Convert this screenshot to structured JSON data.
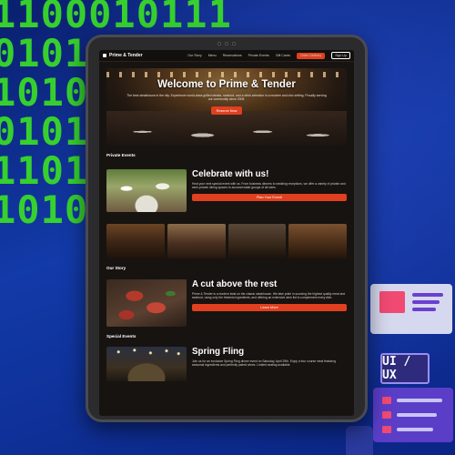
{
  "background_text": {
    "binary_lines": [
      "1100010111",
      "01010",
      "101010",
      "01010",
      "11010",
      "101010"
    ]
  },
  "site": {
    "brand": "Prime & Tender",
    "nav_links": [
      "Our Story",
      "Menu",
      "Reservations",
      "Private Events",
      "Gift Cards"
    ],
    "order_button": "Order Delivery",
    "signup_button": "Sign Up"
  },
  "hero": {
    "title": "Welcome to Prime & Tender",
    "subtitle": "The best steakhouse in the city. Experience world-class grilled steaks, seafood, and a drink selection in a modern and chic setting. Proudly serving our community since 2005.",
    "button": "Reserve Now"
  },
  "private_events": {
    "section_label": "Private Events",
    "title": "Celebrate with us!",
    "text": "Host your next special event with us. From business dinners to wedding receptions, we offer a variety of private and semi-private dining spaces to accommodate groups of all sizes.",
    "button": "Plan Your Event!"
  },
  "our_story": {
    "section_label": "Our Story",
    "title": "A cut above the rest",
    "text": "Prime & Tender is a modern twist on the classic steakhouse. We take pride in sourcing the highest quality meat and seafood, using only the freshest ingredients, and offering an extensive wine list to complement every dish.",
    "button": "Learn More"
  },
  "special_events": {
    "section_label": "Special Events",
    "title": "Spring Fling",
    "text": "Join us for an exclusive Spring Fling dinner event on Saturday, April 29th. Enjoy a four course meal featuring seasonal ingredients and perfectly paired wines. Limited seating available."
  },
  "decor": {
    "badge": "UI / UX"
  },
  "colors": {
    "accent": "#e0401f",
    "page_bg": "#171310",
    "binary": "#39d92a",
    "backdrop": "#123aa8"
  }
}
